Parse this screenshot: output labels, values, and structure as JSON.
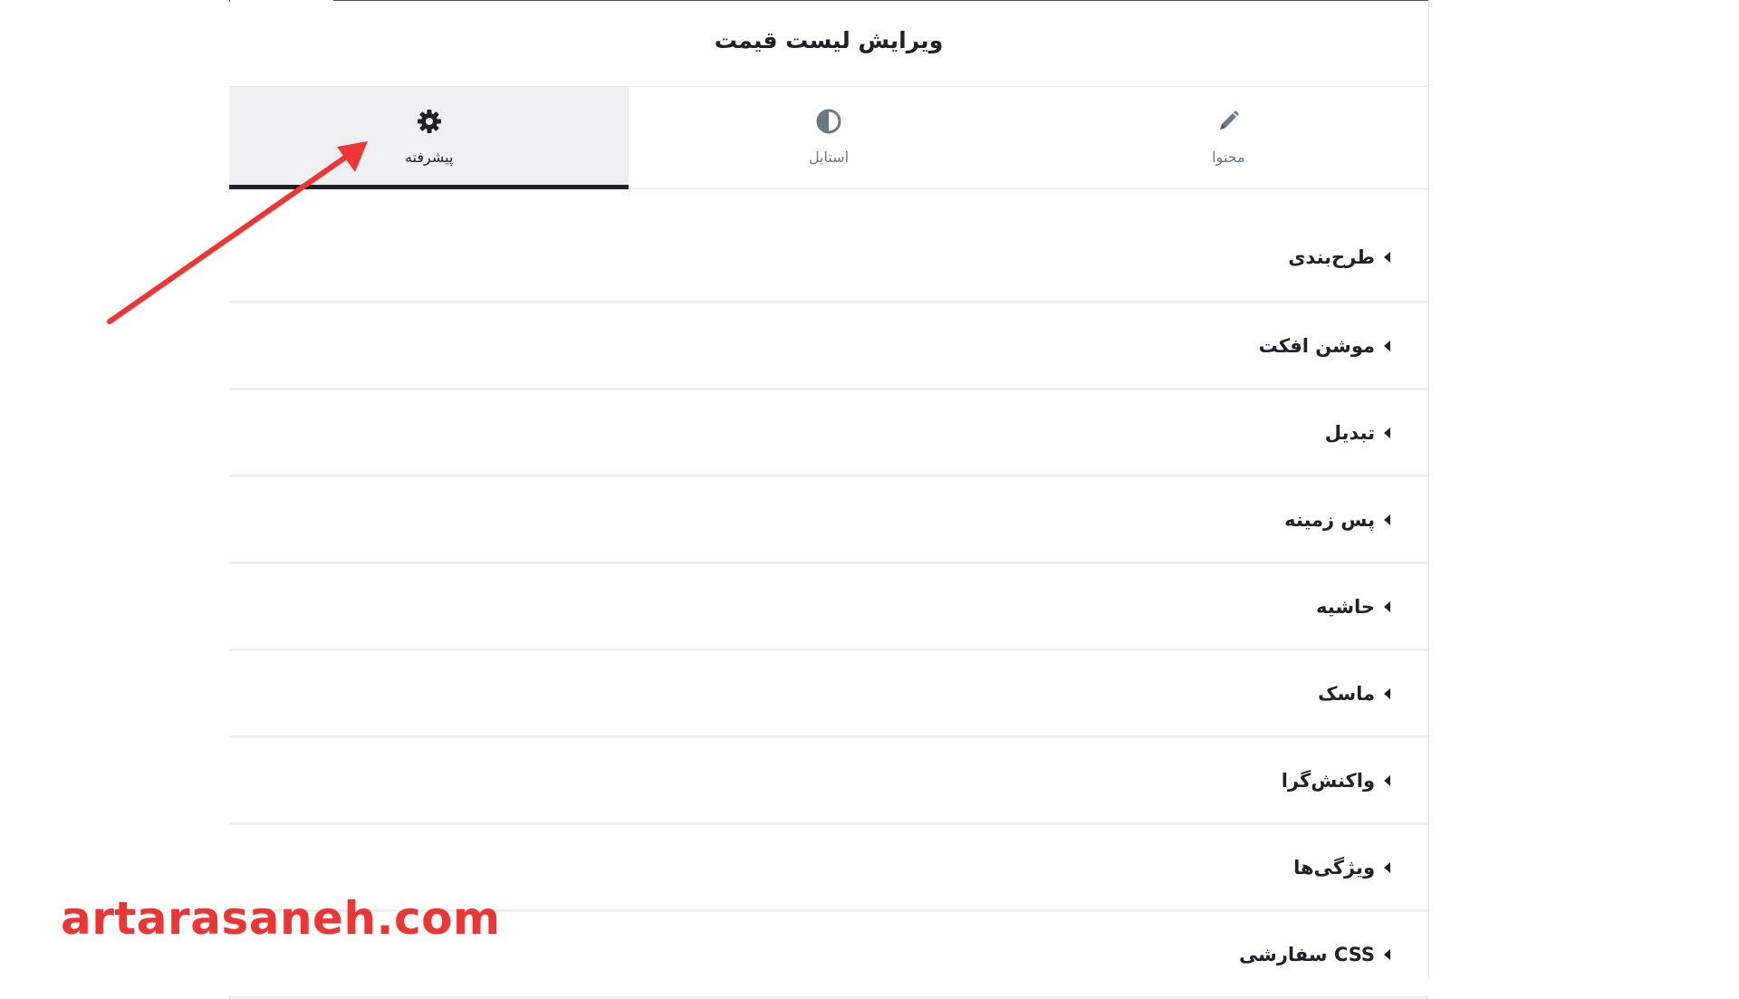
{
  "panel": {
    "title": "ویرایش لیست قیمت"
  },
  "tabs": [
    {
      "label": "محتوا",
      "icon": "pencil-icon",
      "active": false
    },
    {
      "label": "استایل",
      "icon": "half-circle-icon",
      "active": false
    },
    {
      "label": "پیشرفته",
      "icon": "gear-icon",
      "active": true
    }
  ],
  "sections": [
    {
      "label": "طرح‌بندی"
    },
    {
      "label": "موشن افکت"
    },
    {
      "label": "تبدیل"
    },
    {
      "label": "پس زمینه"
    },
    {
      "label": "حاشیه"
    },
    {
      "label": "ماسک"
    },
    {
      "label": "واکنش‌گرا"
    },
    {
      "label": "ویژگی‌ها"
    },
    {
      "label": "CSS سفارشی"
    }
  ],
  "watermark": "artarasaneh.com",
  "colors": {
    "accent_arrow": "#ee3535",
    "active_tab_bg": "#eff0f2",
    "text_dark": "#1f2124",
    "text_muted": "#6d7882"
  }
}
